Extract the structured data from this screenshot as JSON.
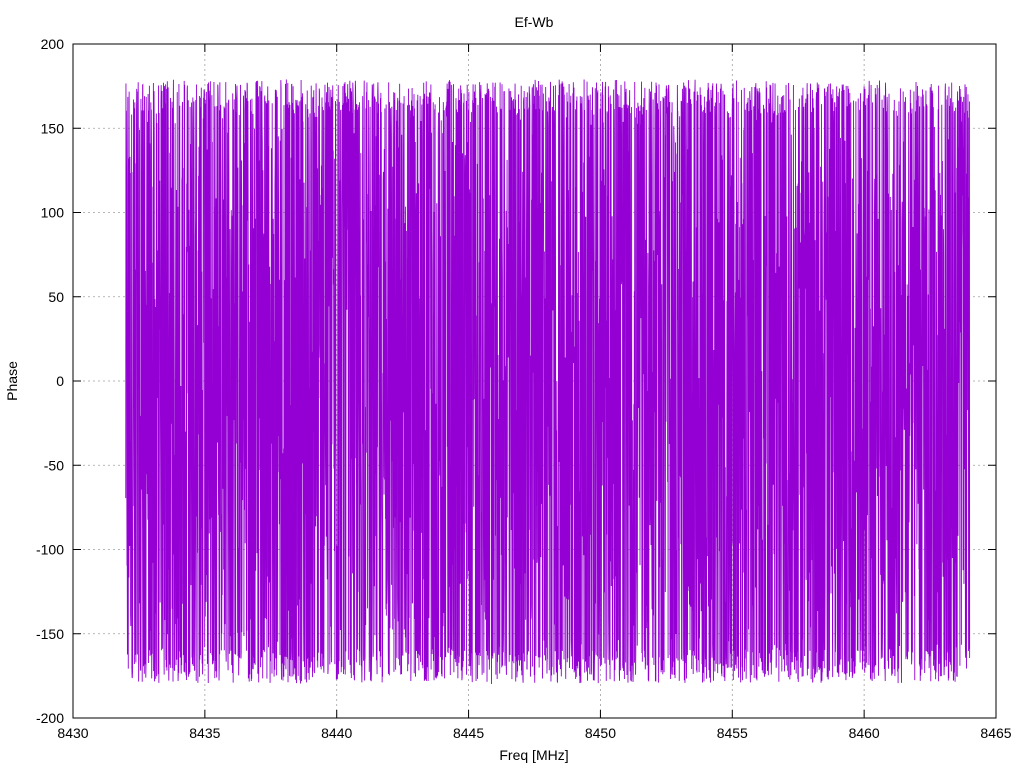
{
  "chart_data": {
    "type": "line",
    "title": "Ef-Wb",
    "xlabel": "Freq [MHz]",
    "ylabel": "Phase",
    "xlim": [
      8430,
      8465
    ],
    "ylim": [
      -200,
      200
    ],
    "xticks": [
      8430,
      8435,
      8440,
      8445,
      8450,
      8455,
      8460,
      8465
    ],
    "yticks": [
      -200,
      -150,
      -100,
      -50,
      0,
      50,
      100,
      150,
      200
    ],
    "grid": true,
    "legend": "none",
    "series": [
      {
        "color": "#9400d3",
        "x_start": 8432,
        "x_end": 8464,
        "envelope": {
          "x": [
            8432,
            8434,
            8436,
            8438,
            8440,
            8442,
            8444,
            8446,
            8448,
            8450,
            8452,
            8454,
            8456,
            8458,
            8460,
            8462,
            8464
          ],
          "y_max": [
            178,
            179,
            178,
            179,
            178,
            179,
            179,
            178,
            179,
            179,
            178,
            179,
            178,
            179,
            179,
            178,
            177
          ],
          "y_min": [
            -178,
            -180,
            -179,
            -180,
            -179,
            -180,
            -179,
            -180,
            -179,
            -180,
            -179,
            -180,
            -179,
            -180,
            -179,
            -180,
            -178
          ]
        },
        "points": 4000,
        "description_values": "dense phase values wrapping between -180 and 180"
      }
    ]
  }
}
